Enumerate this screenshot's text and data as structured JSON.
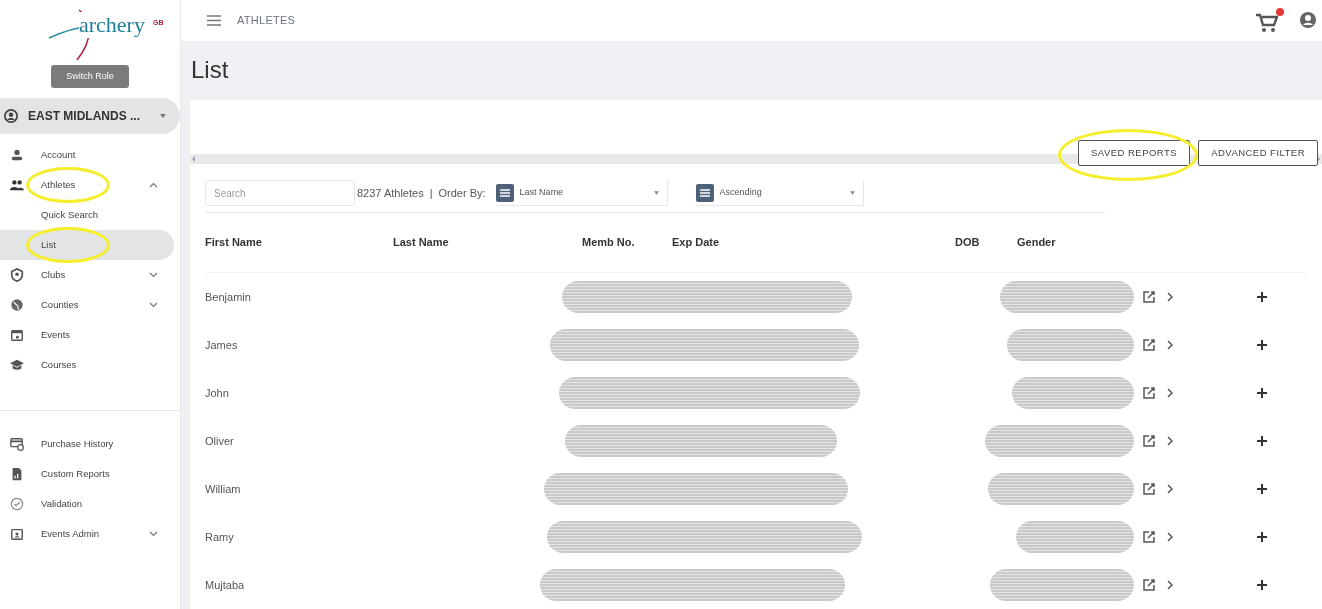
{
  "sidebar": {
    "logo": {
      "text": "archery",
      "superscript": "GB"
    },
    "switch_role": "Switch Role",
    "role": {
      "label": "EAST MIDLANDS ..."
    },
    "items": [
      {
        "kind": "account",
        "label": "Account",
        "selected": false,
        "annotated": false
      },
      {
        "kind": "people",
        "label": "Athletes",
        "selected": false,
        "annotated": true,
        "expanded": true,
        "children": [
          {
            "label": "Quick Search",
            "selected": false,
            "annotated": false
          },
          {
            "label": "List",
            "selected": true,
            "annotated": true
          }
        ]
      },
      {
        "kind": "shield",
        "label": "Clubs",
        "selected": false,
        "annotated": false,
        "expanded": false
      },
      {
        "kind": "globe",
        "label": "Counties",
        "selected": false,
        "annotated": false,
        "expanded": false
      },
      {
        "kind": "calendar",
        "label": "Events",
        "selected": false,
        "annotated": false
      },
      {
        "kind": "cap",
        "label": "Courses",
        "selected": false,
        "annotated": false
      }
    ],
    "lower_items": [
      {
        "kind": "card",
        "label": "Purchase History",
        "selected": false,
        "annotated": false
      },
      {
        "kind": "report",
        "label": "Custom Reports",
        "selected": false,
        "annotated": false
      },
      {
        "kind": "check",
        "label": "Validation",
        "selected": false,
        "annotated": false
      },
      {
        "kind": "calendar-person",
        "label": "Events Admin",
        "selected": false,
        "annotated": false,
        "expanded": false
      }
    ]
  },
  "topbar": {
    "breadcrumb": "ATHLETES",
    "cart_badge": true
  },
  "page_title": "List",
  "buttons": [
    {
      "label": "SAVED REPORTS",
      "annotated": true
    },
    {
      "label": "ADVANCED FILTER",
      "annotated": false
    }
  ],
  "filters": {
    "search_placeholder": "Search",
    "count": "8237 Athletes",
    "separator": "|",
    "order_label": "Order By:",
    "order_by": "Last Name",
    "direction": "Ascending"
  },
  "table": {
    "columns": [
      "First Name",
      "Last Name",
      "Memb No.",
      "Exp Date",
      "DOB",
      "Gender"
    ],
    "rows": [
      {
        "first_name": "Benjamin",
        "redacted": true
      },
      {
        "first_name": "James",
        "redacted": true
      },
      {
        "first_name": "John",
        "redacted": true
      },
      {
        "first_name": "Oliver",
        "redacted": true
      },
      {
        "first_name": "William",
        "redacted": true
      },
      {
        "first_name": "Ramy",
        "redacted": true
      },
      {
        "first_name": "Mujtaba",
        "redacted": true
      }
    ]
  }
}
